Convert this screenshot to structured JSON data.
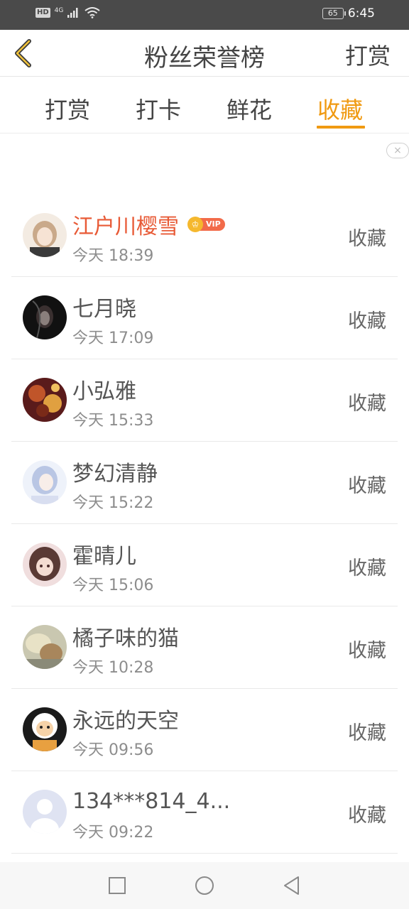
{
  "status_bar": {
    "hd": "HD",
    "network": "4G",
    "battery": "65",
    "time": "6:45"
  },
  "header": {
    "title": "粉丝荣誉榜",
    "action": "打赏"
  },
  "tabs": [
    {
      "label": "打赏",
      "active": false
    },
    {
      "label": "打卡",
      "active": false
    },
    {
      "label": "鲜花",
      "active": false
    },
    {
      "label": "收藏",
      "active": true
    }
  ],
  "ad_close_label": "×",
  "list": [
    {
      "name": "江户川樱雪",
      "vip": true,
      "vip_label": "VIP",
      "time": "今天 18:39",
      "action": "收藏"
    },
    {
      "name": "七月晓",
      "vip": false,
      "time": "今天 17:09",
      "action": "收藏"
    },
    {
      "name": "小弘雅",
      "vip": false,
      "time": "今天 15:33",
      "action": "收藏"
    },
    {
      "name": "梦幻清静",
      "vip": false,
      "time": "今天 15:22",
      "action": "收藏"
    },
    {
      "name": "霍晴儿",
      "vip": false,
      "time": "今天 15:06",
      "action": "收藏"
    },
    {
      "name": "橘子味的猫",
      "vip": false,
      "time": "今天 10:28",
      "action": "收藏"
    },
    {
      "name": "永远的天空",
      "vip": false,
      "time": "今天 09:56",
      "action": "收藏"
    },
    {
      "name": "134***814_4...",
      "vip": false,
      "time": "今天 09:22",
      "action": "收藏"
    }
  ],
  "colors": {
    "accent": "#f09a12",
    "vip_name": "#e85a36"
  },
  "icons": {
    "back": "chevron-left-icon",
    "nav_recent": "square-icon",
    "nav_home": "circle-icon",
    "nav_back": "triangle-back-icon"
  }
}
